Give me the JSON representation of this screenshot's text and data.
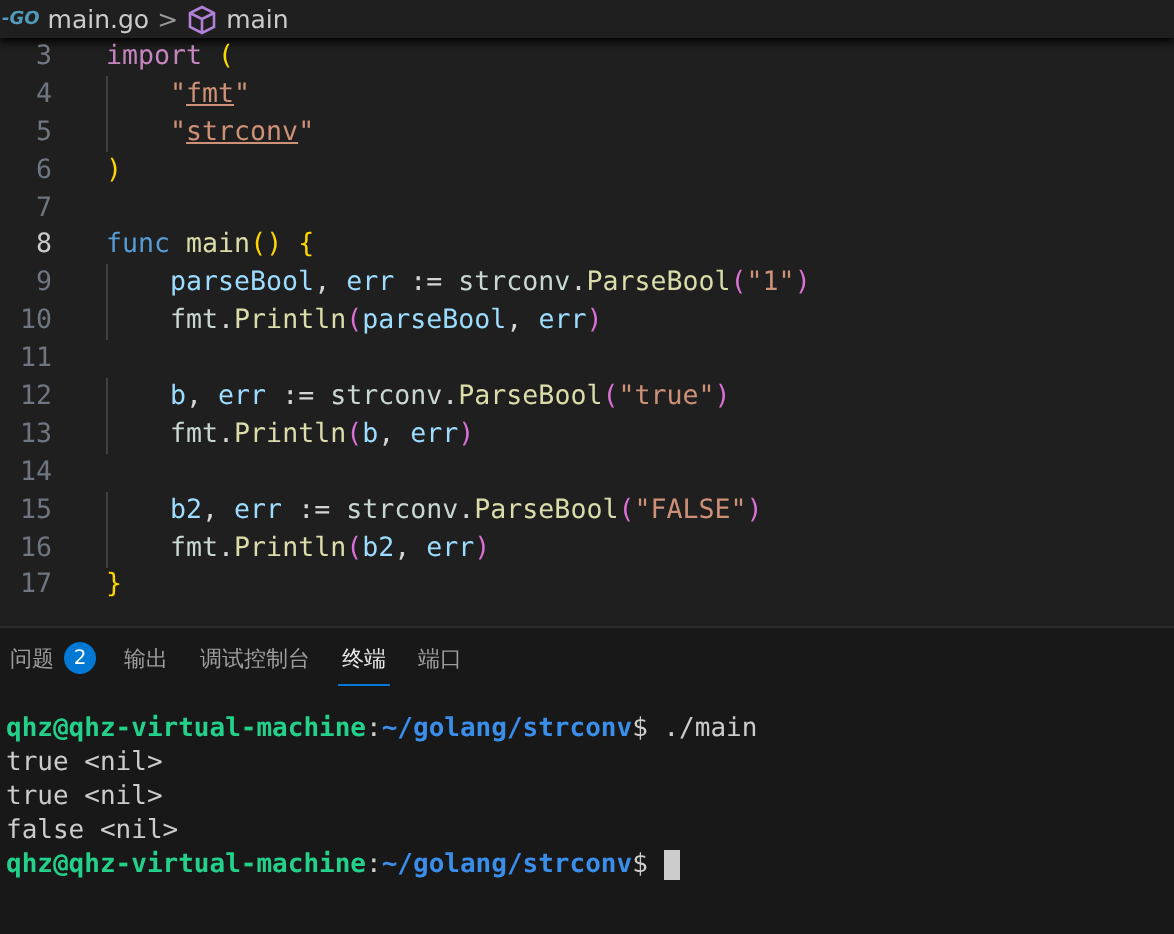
{
  "breadcrumb": {
    "file_badge": "-GO",
    "file": "main.go",
    "separator": ">",
    "symbol": "main"
  },
  "editor": {
    "lines": [
      {
        "number": "3",
        "active": false,
        "tokens": [
          {
            "kind": "import",
            "text": "import "
          },
          {
            "kind": "paren",
            "text": "("
          }
        ]
      },
      {
        "number": "4",
        "active": false,
        "indent": true,
        "tokens": [
          {
            "kind": "str",
            "text": "\""
          },
          {
            "kind": "strlink",
            "text": "fmt"
          },
          {
            "kind": "str",
            "text": "\""
          }
        ]
      },
      {
        "number": "5",
        "active": false,
        "indent": true,
        "tokens": [
          {
            "kind": "str",
            "text": "\""
          },
          {
            "kind": "strlink",
            "text": "strconv"
          },
          {
            "kind": "str",
            "text": "\""
          }
        ]
      },
      {
        "number": "6",
        "active": false,
        "tokens": [
          {
            "kind": "paren",
            "text": ")"
          }
        ]
      },
      {
        "number": "7",
        "active": false
      },
      {
        "number": "8",
        "active": true,
        "tokens": [
          {
            "kind": "kw",
            "text": "func "
          },
          {
            "kind": "fn",
            "text": "main"
          },
          {
            "kind": "paren",
            "text": "() {"
          }
        ]
      },
      {
        "number": "9",
        "active": false,
        "indent": true,
        "tokens": [
          {
            "kind": "var",
            "text": "parseBool"
          },
          {
            "kind": "plain",
            "text": ", "
          },
          {
            "kind": "var",
            "text": "err"
          },
          {
            "kind": "plain",
            "text": " := "
          },
          {
            "kind": "pkg",
            "text": "strconv"
          },
          {
            "kind": "plain",
            "text": "."
          },
          {
            "kind": "fn",
            "text": "ParseBool"
          },
          {
            "kind": "paren2",
            "text": "("
          },
          {
            "kind": "str",
            "text": "\"1\""
          },
          {
            "kind": "paren2",
            "text": ")"
          }
        ]
      },
      {
        "number": "10",
        "active": false,
        "indent": true,
        "tokens": [
          {
            "kind": "pkg",
            "text": "fmt"
          },
          {
            "kind": "plain",
            "text": "."
          },
          {
            "kind": "fn",
            "text": "Println"
          },
          {
            "kind": "paren2",
            "text": "("
          },
          {
            "kind": "var",
            "text": "parseBool"
          },
          {
            "kind": "plain",
            "text": ", "
          },
          {
            "kind": "var",
            "text": "err"
          },
          {
            "kind": "paren2",
            "text": ")"
          }
        ]
      },
      {
        "number": "11",
        "active": false
      },
      {
        "number": "12",
        "active": false,
        "indent": true,
        "tokens": [
          {
            "kind": "var",
            "text": "b"
          },
          {
            "kind": "plain",
            "text": ", "
          },
          {
            "kind": "var",
            "text": "err"
          },
          {
            "kind": "plain",
            "text": " := "
          },
          {
            "kind": "pkg",
            "text": "strconv"
          },
          {
            "kind": "plain",
            "text": "."
          },
          {
            "kind": "fn",
            "text": "ParseBool"
          },
          {
            "kind": "paren2",
            "text": "("
          },
          {
            "kind": "str",
            "text": "\"true\""
          },
          {
            "kind": "paren2",
            "text": ")"
          }
        ]
      },
      {
        "number": "13",
        "active": false,
        "indent": true,
        "tokens": [
          {
            "kind": "pkg",
            "text": "fmt"
          },
          {
            "kind": "plain",
            "text": "."
          },
          {
            "kind": "fn",
            "text": "Println"
          },
          {
            "kind": "paren2",
            "text": "("
          },
          {
            "kind": "var",
            "text": "b"
          },
          {
            "kind": "plain",
            "text": ", "
          },
          {
            "kind": "var",
            "text": "err"
          },
          {
            "kind": "paren2",
            "text": ")"
          }
        ]
      },
      {
        "number": "14",
        "active": false
      },
      {
        "number": "15",
        "active": false,
        "indent": true,
        "tokens": [
          {
            "kind": "var",
            "text": "b2"
          },
          {
            "kind": "plain",
            "text": ", "
          },
          {
            "kind": "var",
            "text": "err"
          },
          {
            "kind": "plain",
            "text": " := "
          },
          {
            "kind": "pkg",
            "text": "strconv"
          },
          {
            "kind": "plain",
            "text": "."
          },
          {
            "kind": "fn",
            "text": "ParseBool"
          },
          {
            "kind": "paren2",
            "text": "("
          },
          {
            "kind": "str",
            "text": "\"FALSE\""
          },
          {
            "kind": "paren2",
            "text": ")"
          }
        ]
      },
      {
        "number": "16",
        "active": false,
        "indent": true,
        "tokens": [
          {
            "kind": "pkg",
            "text": "fmt"
          },
          {
            "kind": "plain",
            "text": "."
          },
          {
            "kind": "fn",
            "text": "Println"
          },
          {
            "kind": "paren2",
            "text": "("
          },
          {
            "kind": "var",
            "text": "b2"
          },
          {
            "kind": "plain",
            "text": ", "
          },
          {
            "kind": "var",
            "text": "err"
          },
          {
            "kind": "paren2",
            "text": ")"
          }
        ]
      },
      {
        "number": "17",
        "active": false,
        "tokens": [
          {
            "kind": "paren",
            "text": "}"
          }
        ]
      }
    ]
  },
  "panel": {
    "tabs": [
      {
        "label": "问题",
        "badge": "2",
        "selected": false
      },
      {
        "label": "输出",
        "selected": false
      },
      {
        "label": "调试控制台",
        "selected": false
      },
      {
        "label": "终端",
        "selected": true
      },
      {
        "label": "端口",
        "selected": false
      }
    ]
  },
  "terminal": {
    "lines": [
      {
        "cursor": false,
        "tokens": [
          {
            "kind": "user",
            "text": "qhz@qhz-virtual-machine"
          },
          {
            "kind": "plain",
            "text": ":"
          },
          {
            "kind": "path",
            "text": "~/golang/strconv"
          },
          {
            "kind": "plain",
            "text": "$ ./main"
          }
        ]
      },
      {
        "cursor": false,
        "tokens": [
          {
            "kind": "plain",
            "text": "true <nil>"
          }
        ]
      },
      {
        "cursor": false,
        "tokens": [
          {
            "kind": "plain",
            "text": "true <nil>"
          }
        ]
      },
      {
        "cursor": false,
        "tokens": [
          {
            "kind": "plain",
            "text": "false <nil>"
          }
        ]
      },
      {
        "cursor": true,
        "tokens": [
          {
            "kind": "user",
            "text": "qhz@qhz-virtual-machine"
          },
          {
            "kind": "plain",
            "text": ":"
          },
          {
            "kind": "path",
            "text": "~/golang/strconv"
          },
          {
            "kind": "plain",
            "text": "$"
          }
        ]
      }
    ]
  }
}
